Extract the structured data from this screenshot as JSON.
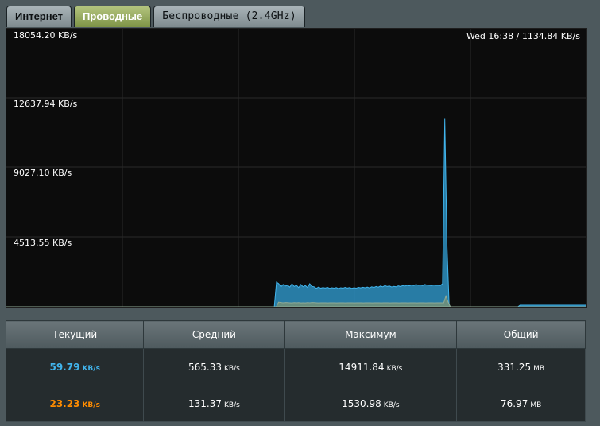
{
  "tabs": [
    {
      "label": "Интернет"
    },
    {
      "label": "Проводные"
    },
    {
      "label": "Беспроводные (2.4GHz)"
    }
  ],
  "chart": {
    "y_labels": [
      "18054.20 KB/s",
      "12637.94 KB/s",
      "9027.10 KB/s",
      "4513.55 KB/s"
    ],
    "timestamp": "Wed 16:38 / 1134.84 KB/s",
    "colors": {
      "rx": "#2e91c1",
      "rx_line": "#41b4ec",
      "tx": "#6f8f7a",
      "background": "#0c0c0c"
    }
  },
  "chart_data": {
    "type": "area",
    "ylim": [
      0,
      18054.2
    ],
    "series": [
      {
        "values": [
          0,
          0,
          0,
          0,
          0,
          0,
          0,
          0,
          0,
          0,
          0,
          0,
          0,
          0,
          0,
          0,
          0,
          0,
          0,
          0,
          0,
          0,
          0,
          0,
          0,
          0,
          0,
          0,
          0,
          0,
          0,
          0,
          0,
          0,
          0,
          0,
          0,
          0,
          0,
          0,
          0,
          0,
          0,
          0,
          0,
          0,
          0,
          0,
          0,
          0,
          0,
          0,
          0,
          0,
          0,
          0,
          0,
          0,
          0,
          0,
          0,
          0,
          0,
          0,
          0,
          0,
          0,
          0,
          0,
          0,
          0,
          0,
          0,
          0,
          0,
          0,
          0,
          0,
          0,
          0,
          0,
          0,
          0,
          0,
          0,
          0,
          0,
          0,
          0,
          0,
          0,
          0,
          0,
          0,
          0,
          0,
          0,
          0,
          0,
          0,
          0,
          0,
          0,
          0,
          0,
          0,
          0,
          0,
          0,
          0,
          0,
          0,
          0,
          0,
          0,
          0,
          0,
          0,
          0,
          0,
          0,
          0,
          1600,
          1500,
          1300,
          1450,
          1350,
          1400,
          1280,
          1500,
          1320,
          1400,
          1250,
          1450,
          1300,
          1380,
          1260,
          1500,
          1330,
          1300,
          1200,
          1280,
          1210,
          1250,
          1220,
          1260,
          1200,
          1240,
          1210,
          1250,
          1190,
          1240,
          1210,
          1260,
          1220,
          1250,
          1200,
          1240,
          1210,
          1260,
          1230,
          1270,
          1240,
          1280,
          1230,
          1300,
          1260,
          1320,
          1280,
          1350,
          1300,
          1380,
          1320,
          1350,
          1290,
          1330,
          1300,
          1360,
          1320,
          1380,
          1340,
          1400,
          1360,
          1420,
          1380,
          1450,
          1400,
          1420,
          1380,
          1450,
          1410,
          1400,
          1380,
          1420,
          1390,
          1400,
          1380,
          1500,
          12200,
          4000,
          0,
          0,
          0,
          0,
          0,
          0,
          0,
          0,
          0,
          0,
          0,
          0,
          0,
          0,
          0,
          0,
          0,
          0,
          0,
          0,
          0,
          0,
          0,
          0,
          0,
          0,
          0,
          0,
          0,
          0,
          0,
          0,
          100,
          100,
          100,
          100,
          100,
          100,
          100,
          100,
          100,
          100,
          100,
          100,
          100,
          100,
          100,
          100,
          100,
          100,
          100,
          100,
          100,
          100,
          100,
          100,
          100,
          100,
          100,
          100,
          100,
          100,
          100
        ]
      },
      {
        "values": [
          0,
          0,
          0,
          0,
          0,
          0,
          0,
          0,
          0,
          0,
          0,
          0,
          0,
          0,
          0,
          0,
          0,
          0,
          0,
          0,
          0,
          0,
          0,
          0,
          0,
          0,
          0,
          0,
          0,
          0,
          0,
          0,
          0,
          0,
          0,
          0,
          0,
          0,
          0,
          0,
          0,
          0,
          0,
          0,
          0,
          0,
          0,
          0,
          0,
          0,
          0,
          0,
          0,
          0,
          0,
          0,
          0,
          0,
          0,
          0,
          0,
          0,
          0,
          0,
          0,
          0,
          0,
          0,
          0,
          0,
          0,
          0,
          0,
          0,
          0,
          0,
          0,
          0,
          0,
          0,
          0,
          0,
          0,
          0,
          0,
          0,
          0,
          0,
          0,
          0,
          0,
          0,
          0,
          0,
          0,
          0,
          0,
          0,
          0,
          0,
          0,
          0,
          0,
          0,
          0,
          0,
          0,
          0,
          0,
          0,
          0,
          0,
          0,
          0,
          0,
          0,
          0,
          0,
          0,
          0,
          0,
          0,
          300,
          280,
          260,
          280,
          270,
          260,
          250,
          270,
          260,
          270,
          250,
          260,
          250,
          270,
          260,
          280,
          270,
          260,
          250,
          260,
          255,
          260,
          250,
          260,
          255,
          260,
          250,
          260,
          255,
          260,
          250,
          260,
          255,
          260,
          250,
          260,
          255,
          260,
          250,
          260,
          255,
          260,
          250,
          260,
          255,
          260,
          250,
          260,
          255,
          260,
          250,
          260,
          255,
          260,
          250,
          260,
          255,
          260,
          250,
          260,
          255,
          260,
          250,
          260,
          255,
          260,
          250,
          260,
          255,
          260,
          250,
          260,
          255,
          260,
          250,
          700,
          300,
          0,
          0,
          0,
          0,
          0,
          0,
          0,
          0,
          0,
          0,
          0,
          0,
          0,
          0,
          0,
          0,
          0,
          0,
          0,
          0,
          0,
          0,
          0,
          0,
          0,
          0,
          0,
          0,
          0,
          0,
          0,
          0,
          0,
          0,
          0,
          0,
          0,
          0,
          0,
          0,
          0,
          0,
          0,
          0,
          0,
          0,
          0,
          0,
          0,
          0,
          0,
          0,
          0,
          0,
          0,
          0,
          0,
          0,
          0,
          0,
          0,
          0
        ]
      }
    ]
  },
  "table": {
    "headers": [
      "Текущий",
      "Средний",
      "Максимум",
      "Общий"
    ],
    "rows": [
      {
        "current": "59.79",
        "current_unit": "KB/s",
        "avg": "565.33",
        "avg_unit": "KB/s",
        "max": "14911.84",
        "max_unit": "KB/s",
        "total": "331.25",
        "total_unit": "MB"
      },
      {
        "current": "23.23",
        "current_unit": "KB/s",
        "avg": "131.37",
        "avg_unit": "KB/s",
        "max": "1530.98",
        "max_unit": "KB/s",
        "total": "76.97",
        "total_unit": "MB"
      }
    ]
  }
}
